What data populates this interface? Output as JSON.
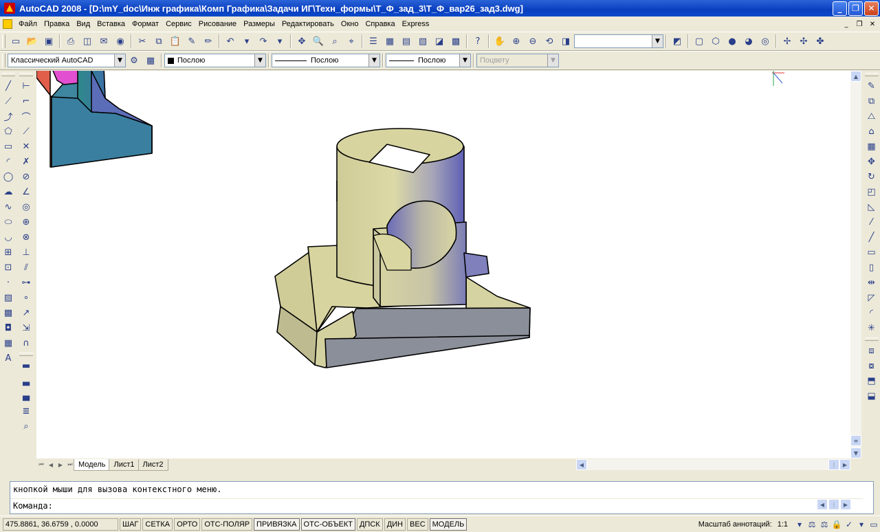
{
  "window": {
    "title": "AutoCAD 2008 - [D:\\mY_doc\\Инж графика\\Комп Графика\\Задачи ИГ\\Техн_формы\\Т_Ф_зад_3\\Т_Ф_вар26_зад3.dwg]",
    "minimize_glyph": "_",
    "restore_glyph": "❐",
    "close_glyph": "✕"
  },
  "menu": {
    "items": [
      "Файл",
      "Правка",
      "Вид",
      "Вставка",
      "Формат",
      "Сервис",
      "Рисование",
      "Размеры",
      "Редактировать",
      "Окно",
      "Справка",
      "Express"
    ],
    "doc_min": "_",
    "doc_restore": "❐",
    "doc_close": "✕"
  },
  "toolbar": {
    "workspace": "Классический AutoCAD",
    "layer": "Послою",
    "linetype": "Послою",
    "lineweight": "Послою",
    "plotstyle": "Поцвету",
    "named_view": ""
  },
  "tabs": [
    "Модель",
    "Лист1",
    "Лист2"
  ],
  "command": {
    "history": "кнопкой мыши для вызова контекстного меню.",
    "prompt": "Команда:"
  },
  "status": {
    "coords": "475.8861, 36.6759 , 0.0000",
    "toggles": [
      "ШАГ",
      "СЕТКА",
      "ОРТО",
      "ОТС-ПОЛЯР",
      "ПРИВЯЗКА",
      "ОТС-ОБЪЕКТ",
      "ДПСК",
      "ДИН",
      "ВЕС",
      "МОДЕЛЬ"
    ],
    "annotation_label": "Масштаб аннотаций:",
    "annotation_value": "1:1"
  },
  "colors": {
    "model_light": "#d9d6a2",
    "model_blue": "#6e6ec0",
    "model_grey": "#8b8f99",
    "partial_teal": "#3f86a0",
    "partial_red": "#e05e4a",
    "partial_magenta": "#e24fd0"
  }
}
